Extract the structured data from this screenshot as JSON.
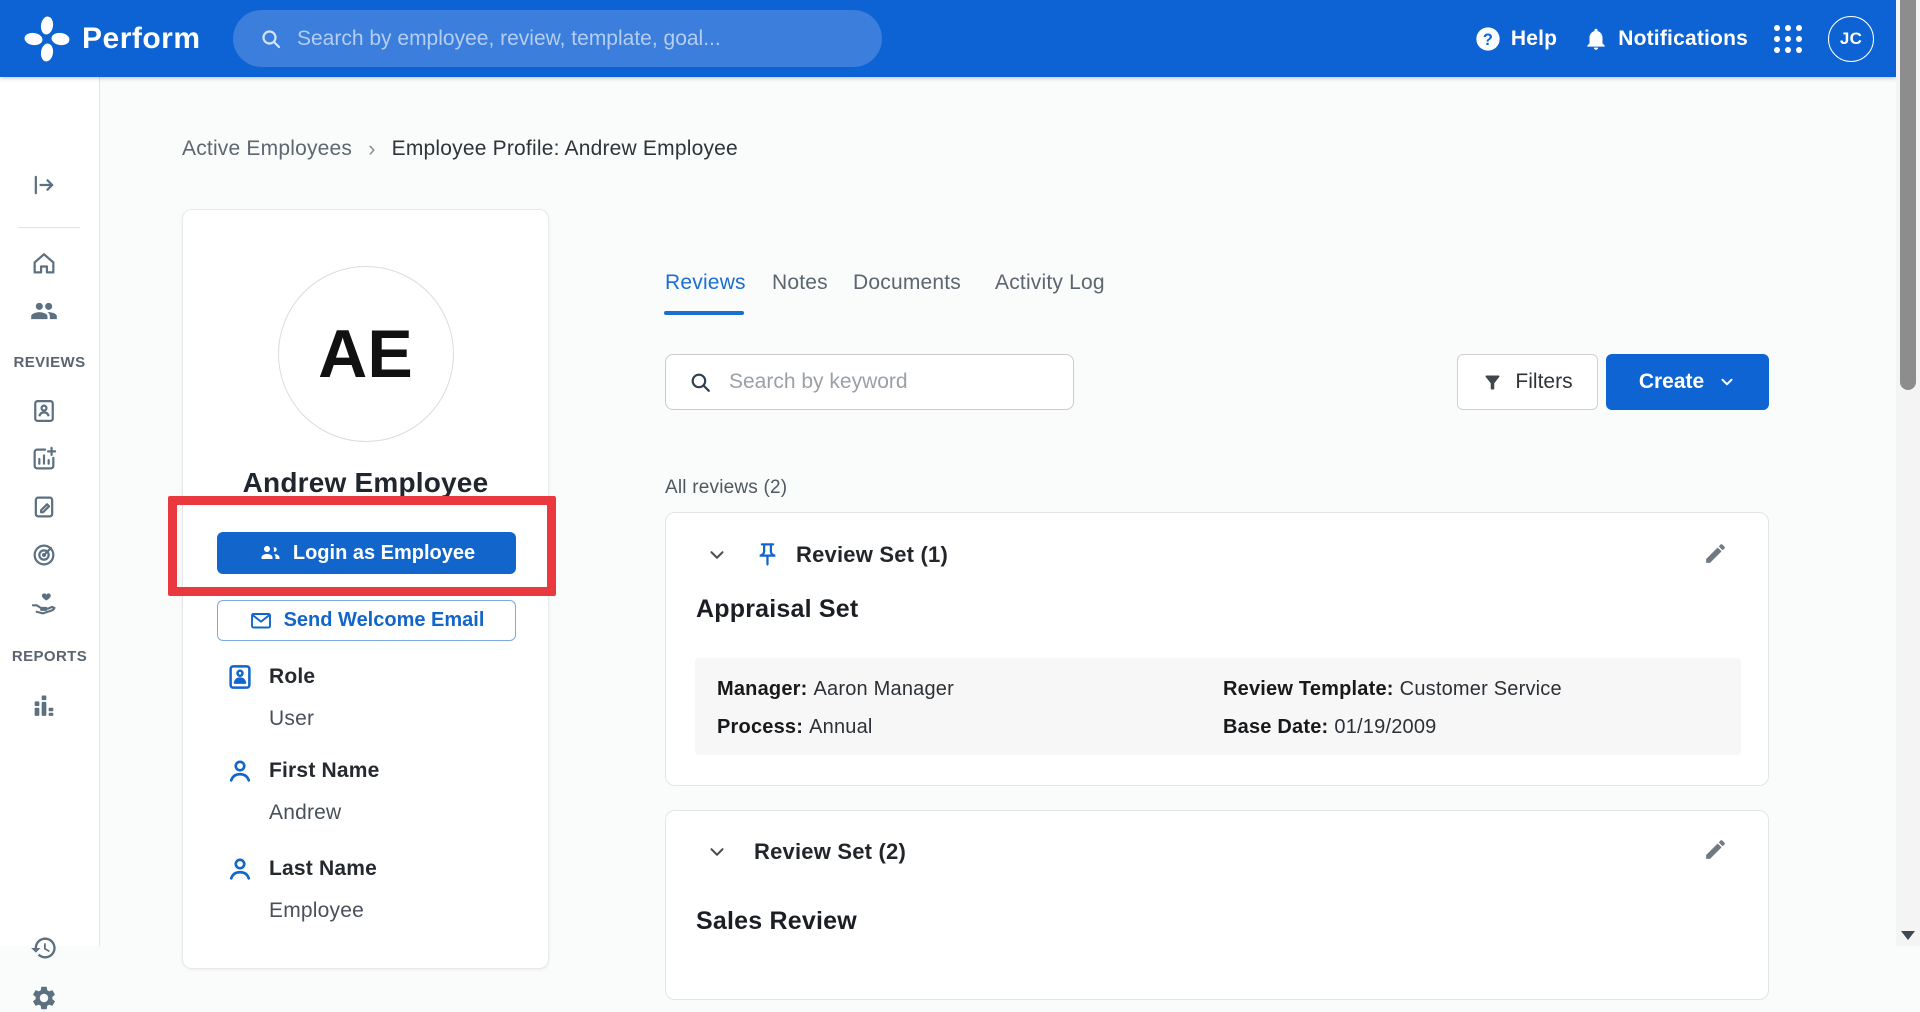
{
  "topbar": {
    "brand": "Perform",
    "search_placeholder": "Search by employee, review, template, goal...",
    "help_label": "Help",
    "notifications_label": "Notifications",
    "avatar_initials": "JC",
    "colors": {
      "bar": "#0d63d3",
      "search_pill": "#3b7edb"
    }
  },
  "sidebar": {
    "reviews_label": "REVIEWS",
    "reports_label": "REPORTS",
    "icon_color": "#5c7080"
  },
  "breadcrumb": {
    "parent": "Active Employees",
    "separator": "›",
    "current": "Employee Profile: Andrew Employee"
  },
  "profile": {
    "initials": "AE",
    "name": "Andrew Employee",
    "login_button": "Login as Employee",
    "welcome_button": "Send Welcome Email",
    "fields": [
      {
        "label": "Role",
        "value": "User"
      },
      {
        "label": "First Name",
        "value": "Andrew"
      },
      {
        "label": "Last Name",
        "value": "Employee"
      }
    ]
  },
  "main": {
    "tabs": [
      {
        "label": "Reviews",
        "active": true
      },
      {
        "label": "Notes",
        "active": false
      },
      {
        "label": "Documents",
        "active": false
      },
      {
        "label": "Activity Log",
        "active": false
      }
    ],
    "search_placeholder": "Search by keyword",
    "filters_button": "Filters",
    "create_button": "Create",
    "section_label": "All reviews (2)",
    "review_cards": [
      {
        "set_label": "Review Set (1)",
        "pinned": true,
        "title": "Appraisal Set",
        "fields": [
          {
            "label": "Manager:",
            "value": "Aaron Manager"
          },
          {
            "label": "Review Template:",
            "value": "Customer Service"
          },
          {
            "label": "Process:",
            "value": "Annual"
          },
          {
            "label": "Base Date:",
            "value": "01/19/2009"
          }
        ]
      },
      {
        "set_label": "Review Set (2)",
        "pinned": false,
        "title": "Sales Review"
      }
    ]
  },
  "annotation": {
    "color": "#e9393f"
  },
  "scrollbar": {
    "thumb_color": "#8d8d8d"
  }
}
